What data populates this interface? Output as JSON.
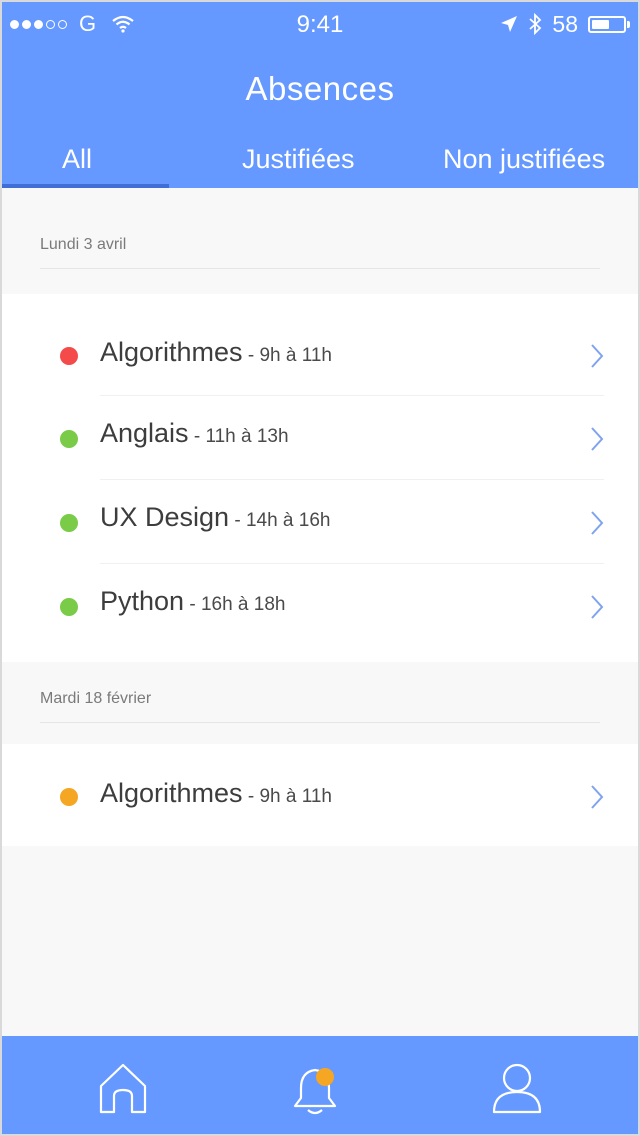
{
  "status_bar": {
    "carrier": "G",
    "time": "9:41",
    "battery_percent": "58",
    "signal_dots_filled": 3,
    "signal_dots_total": 5
  },
  "header": {
    "title": "Absences"
  },
  "tabs": [
    {
      "label": "All",
      "active": true
    },
    {
      "label": "Justifiées",
      "active": false
    },
    {
      "label": "Non justifiées",
      "active": false
    }
  ],
  "sections": [
    {
      "date": "Lundi 3 avril",
      "items": [
        {
          "course": "Algorithmes",
          "time": " - 9h à 11h",
          "status_color": "#f44a4a"
        },
        {
          "course": "Anglais",
          "time": " - 11h à 13h",
          "status_color": "#7acb48"
        },
        {
          "course": "UX Design",
          "time": " - 14h à 16h",
          "status_color": "#7acb48"
        },
        {
          "course": "Python",
          "time": " - 16h à 18h",
          "status_color": "#7acb48"
        }
      ]
    },
    {
      "date": "Mardi 18 février",
      "items": [
        {
          "course": "Algorithmes",
          "time": " - 9h à 11h",
          "status_color": "#f5a623"
        }
      ]
    }
  ],
  "bottom_nav": {
    "items": [
      "home-icon",
      "bell-icon",
      "user-icon"
    ],
    "notification_badge_color": "#f5a623"
  },
  "colors": {
    "accent": "#6699ff",
    "tab_indicator": "#3f6fd4",
    "chevron": "#7fa3ee"
  }
}
